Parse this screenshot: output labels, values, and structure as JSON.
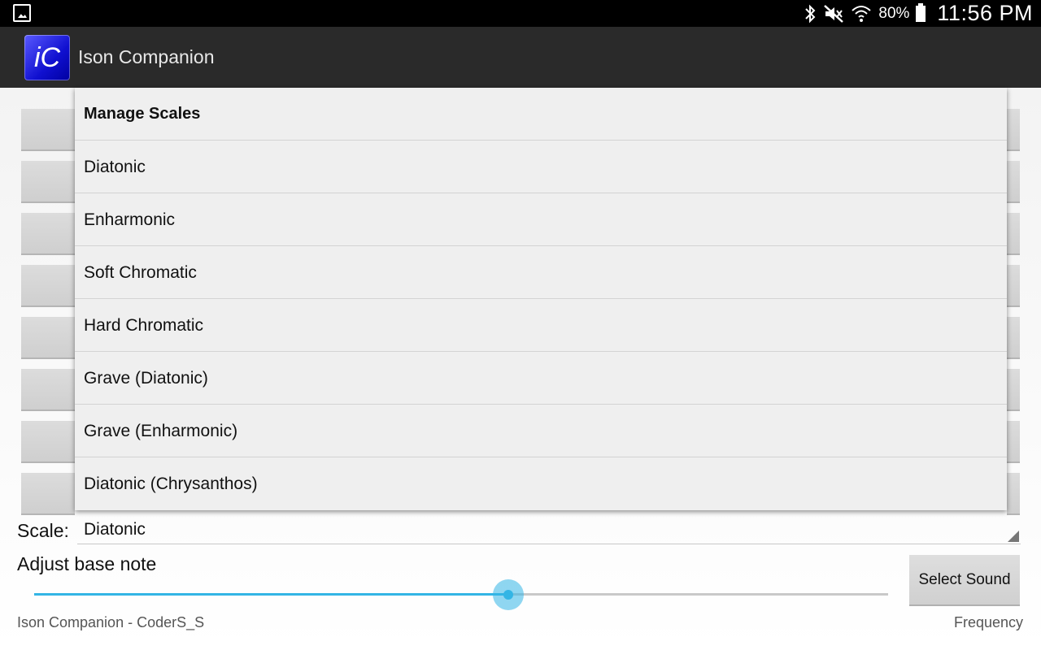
{
  "status_bar": {
    "battery_percent": "80%",
    "time": "11:56 PM",
    "icons": [
      "gallery-notification-icon",
      "bluetooth-icon",
      "mute-icon",
      "wifi-icon",
      "battery-icon"
    ]
  },
  "action_bar": {
    "app_icon_text": "iC",
    "title": "Ison Companion"
  },
  "dropdown": {
    "header": "Manage Scales",
    "items": [
      "Diatonic",
      "Enharmonic",
      "Soft Chromatic",
      "Hard Chromatic",
      "Grave (Diatonic)",
      "Grave (Enharmonic)",
      "Diatonic (Chrysanthos)"
    ]
  },
  "scale": {
    "label": "Scale:",
    "value": "Diatonic"
  },
  "base_note": {
    "label": "Adjust base note",
    "slider_fraction": 0.555
  },
  "select_sound_label": "Select Sound",
  "footer": {
    "left": "Ison Companion - CoderS_S",
    "right": "Frequency"
  },
  "colors": {
    "accent": "#33b5e5",
    "action_bar": "#2a2a2a"
  }
}
